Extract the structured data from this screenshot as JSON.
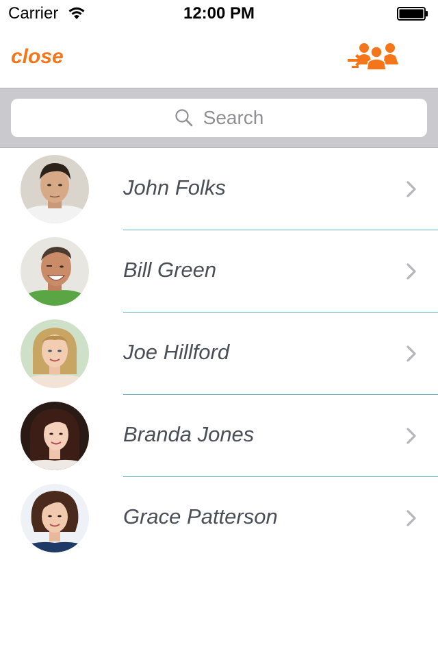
{
  "status_bar": {
    "carrier": "Carrier",
    "time": "12:00 PM",
    "wifi_icon": "wifi-icon",
    "battery_icon": "battery-icon"
  },
  "navbar": {
    "close_label": "close",
    "group_icon": "group-transfer-icon",
    "accent_color": "#f5761a"
  },
  "search": {
    "placeholder": "Search",
    "icon": "search-icon"
  },
  "contacts": [
    {
      "name": "John Folks"
    },
    {
      "name": "Bill Green"
    },
    {
      "name": "Joe Hillford"
    },
    {
      "name": "Branda Jones"
    },
    {
      "name": "Grace Patterson"
    }
  ],
  "colors": {
    "separator": "#5fb7c4",
    "name_text": "#4a4f57",
    "search_bar_bg": "#c9c9ce"
  }
}
